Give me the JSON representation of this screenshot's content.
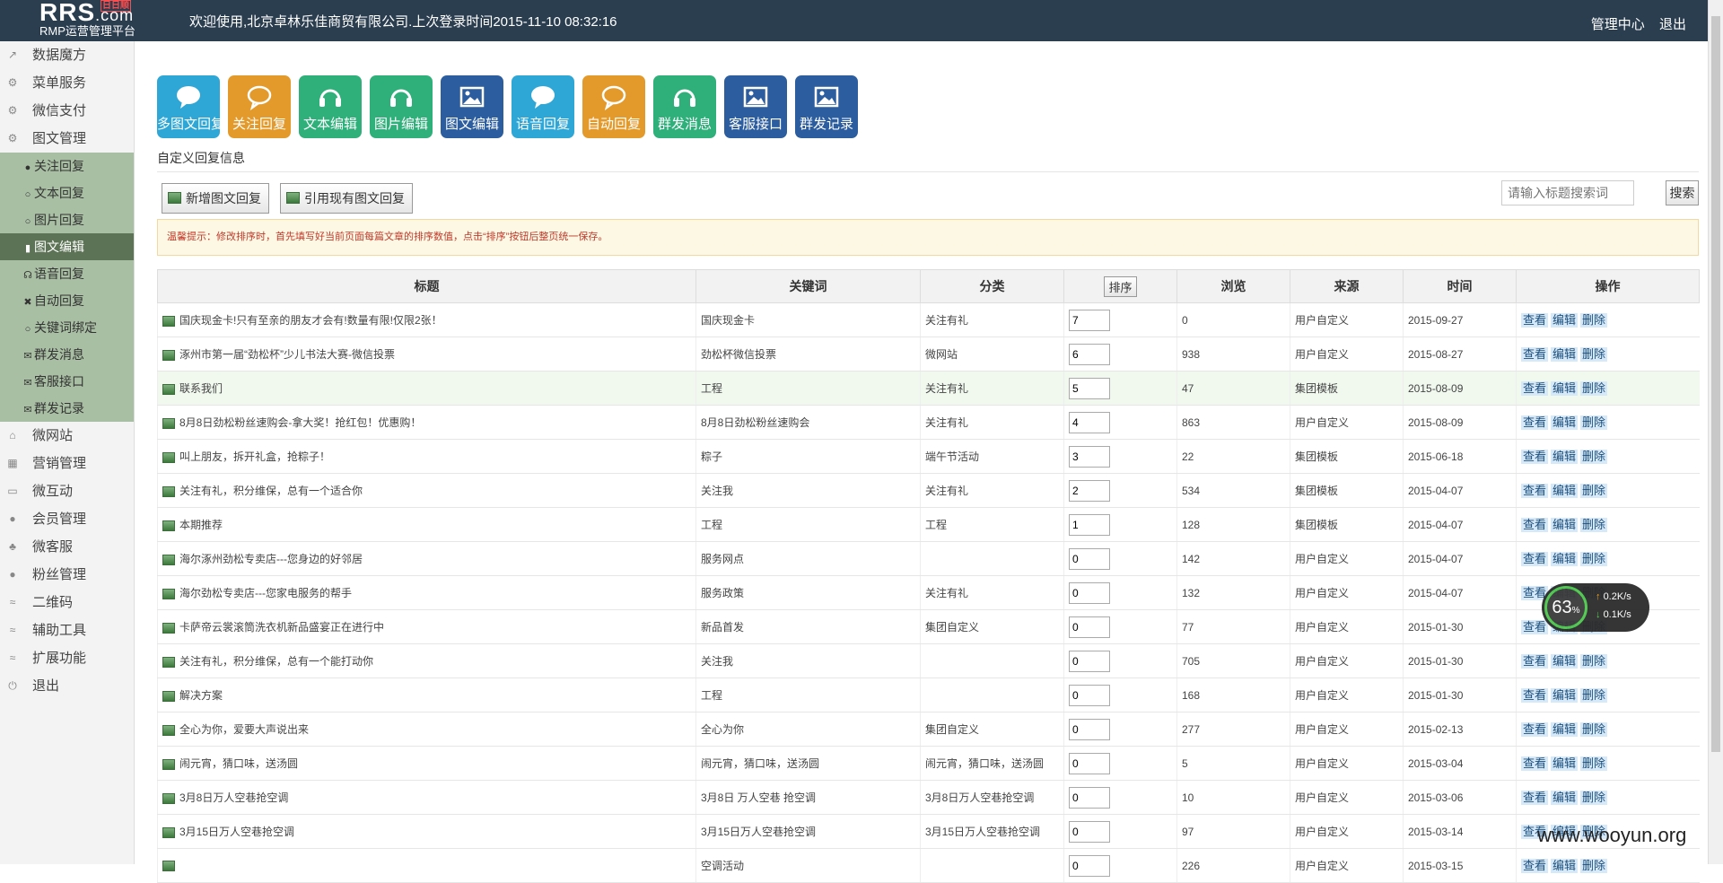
{
  "header": {
    "logo_brand": "RRS",
    "logo_domain": ".com",
    "logo_tag": "日日顺",
    "logo_sub": "RMP运营管理平台",
    "welcome": "欢迎使用,北京卓林乐佳商贸有限公司.上次登录时间2015-11-10 08:32:16",
    "link_admin": "管理中心",
    "link_logout": "退出"
  },
  "sidebar": {
    "top_items": [
      {
        "label": "数据魔方",
        "icon": "↗"
      },
      {
        "label": "菜单服务",
        "icon": "⚙"
      },
      {
        "label": "微信支付",
        "icon": "⚙"
      },
      {
        "label": "图文管理",
        "icon": "⚙"
      }
    ],
    "sub_items": [
      {
        "label": "关注回复",
        "icon": "●"
      },
      {
        "label": "文本回复",
        "icon": "○"
      },
      {
        "label": "图片回复",
        "icon": "○"
      },
      {
        "label": "图文编辑",
        "icon": "▮",
        "active": true
      },
      {
        "label": "语音回复",
        "icon": "☊"
      },
      {
        "label": "自动回复",
        "icon": "✖"
      },
      {
        "label": "关键词绑定",
        "icon": "○"
      },
      {
        "label": "群发消息",
        "icon": "✉"
      },
      {
        "label": "客服接口",
        "icon": "✉"
      },
      {
        "label": "群发记录",
        "icon": "✉"
      }
    ],
    "bottom_items": [
      {
        "label": "微网站",
        "icon": "⌂"
      },
      {
        "label": "营销管理",
        "icon": "▦"
      },
      {
        "label": "微互动",
        "icon": "▭"
      },
      {
        "label": "会员管理",
        "icon": "●"
      },
      {
        "label": "微客服",
        "icon": "♣"
      },
      {
        "label": "粉丝管理",
        "icon": "●"
      },
      {
        "label": "二维码",
        "icon": "≈"
      },
      {
        "label": "辅助工具",
        "icon": "≈"
      },
      {
        "label": "扩展功能",
        "icon": "≈"
      },
      {
        "label": "退出",
        "icon": "⏻"
      }
    ]
  },
  "tiles": [
    {
      "label": "多图文回复",
      "icon": "chat-icon",
      "color": "#2ea7d6"
    },
    {
      "label": "关注回复",
      "icon": "chat-outline-icon",
      "color": "#e39a2a"
    },
    {
      "label": "文本编辑",
      "icon": "headphones-icon",
      "color": "#2fb07a"
    },
    {
      "label": "图片编辑",
      "icon": "headphones-icon",
      "color": "#2fb07a"
    },
    {
      "label": "图文编辑",
      "icon": "picture-icon",
      "color": "#2c5d9f"
    },
    {
      "label": "语音回复",
      "icon": "chat-icon",
      "color": "#2ea7d6"
    },
    {
      "label": "自动回复",
      "icon": "chat-outline-icon",
      "color": "#e39a2a"
    },
    {
      "label": "群发消息",
      "icon": "headphones-icon",
      "color": "#2fb07a"
    },
    {
      "label": "客服接口",
      "icon": "picture-icon",
      "color": "#2c5d9f"
    },
    {
      "label": "群发记录",
      "icon": "picture-icon",
      "color": "#2c5d9f"
    }
  ],
  "main": {
    "section_title": "自定义回复信息",
    "btn_new": "新增图文回复",
    "btn_ref": "引用现有图文回复",
    "search_placeholder": "请输入标题搜索词",
    "search_btn": "搜索",
    "notice": "温馨提示：修改排序时，首先填写好当前页面每篇文章的排序数值，点击“排序”按钮后整页统一保存。"
  },
  "table": {
    "headers": {
      "title": "标题",
      "keyword": "关键词",
      "category": "分类",
      "sort": "排序",
      "views": "浏览",
      "source": "来源",
      "time": "时间",
      "ops": "操作"
    },
    "op_labels": {
      "view": "查看",
      "edit": "编辑",
      "del": "删除"
    },
    "rows": [
      {
        "title": "国庆现金卡!只有至亲的朋友才会有!数量有限!仅限2张！",
        "keyword": "国庆现金卡",
        "category": "关注有礼",
        "sort": "7",
        "views": "0",
        "source": "用户自定义",
        "time": "2015-09-27"
      },
      {
        "title": "涿州市第一届“劲松杯”少儿书法大赛-微信投票",
        "keyword": "劲松杯微信投票",
        "category": "微网站",
        "sort": "6",
        "views": "938",
        "source": "用户自定义",
        "time": "2015-08-27"
      },
      {
        "title": "联系我们",
        "keyword": "工程",
        "category": "关注有礼",
        "sort": "5",
        "views": "47",
        "source": "集团模板",
        "time": "2015-08-09"
      },
      {
        "title": "8月8日劲松粉丝速购会-拿大奖！抢红包！优惠购！",
        "keyword": "8月8日劲松粉丝速购会",
        "category": "关注有礼",
        "sort": "4",
        "views": "863",
        "source": "用户自定义",
        "time": "2015-08-09"
      },
      {
        "title": "叫上朋友，拆开礼盒，抢粽子！",
        "keyword": "粽子",
        "category": "端午节活动",
        "sort": "3",
        "views": "22",
        "source": "集团模板",
        "time": "2015-06-18"
      },
      {
        "title": "关注有礼，积分维保，总有一个适合你",
        "keyword": "关注我",
        "category": "关注有礼",
        "sort": "2",
        "views": "534",
        "source": "集团模板",
        "time": "2015-04-07"
      },
      {
        "title": "本期推荐",
        "keyword": "工程",
        "category": "工程",
        "sort": "1",
        "views": "128",
        "source": "集团模板",
        "time": "2015-04-07"
      },
      {
        "title": "海尔涿州劲松专卖店---您身边的好邻居",
        "keyword": "服务网点",
        "category": "",
        "sort": "0",
        "views": "142",
        "source": "用户自定义",
        "time": "2015-04-07"
      },
      {
        "title": "海尔劲松专卖店---您家电服务的帮手",
        "keyword": "服务政策",
        "category": "关注有礼",
        "sort": "0",
        "views": "132",
        "source": "用户自定义",
        "time": "2015-04-07"
      },
      {
        "title": "卡萨帝云裳滚筒洗衣机新品盛宴正在进行中",
        "keyword": "新品首发",
        "category": "集团自定义",
        "sort": "0",
        "views": "77",
        "source": "用户自定义",
        "time": "2015-01-30"
      },
      {
        "title": "关注有礼，积分维保，总有一个能打动你",
        "keyword": "关注我",
        "category": "",
        "sort": "0",
        "views": "705",
        "source": "用户自定义",
        "time": "2015-01-30"
      },
      {
        "title": "解决方案",
        "keyword": "工程",
        "category": "",
        "sort": "0",
        "views": "168",
        "source": "用户自定义",
        "time": "2015-01-30"
      },
      {
        "title": "全心为你，爱要大声说出来",
        "keyword": "全心为你",
        "category": "集团自定义",
        "sort": "0",
        "views": "277",
        "source": "用户自定义",
        "time": "2015-02-13"
      },
      {
        "title": "闹元宵，猜口味，送汤圆",
        "keyword": "闹元宵，猜口味，送汤圆",
        "category": "闹元宵，猜口味，送汤圆",
        "sort": "0",
        "views": "5",
        "source": "用户自定义",
        "time": "2015-03-04"
      },
      {
        "title": "3月8日万人空巷抢空调",
        "keyword": "3月8日 万人空巷 抢空调",
        "category": "3月8日万人空巷抢空调",
        "sort": "0",
        "views": "10",
        "source": "用户自定义",
        "time": "2015-03-06"
      },
      {
        "title": "3月15日万人空巷抢空调",
        "keyword": "3月15日万人空巷抢空调",
        "category": "3月15日万人空巷抢空调",
        "sort": "0",
        "views": "97",
        "source": "用户自定义",
        "time": "2015-03-14"
      },
      {
        "title": "",
        "keyword": "空调活动",
        "category": "",
        "sort": "0",
        "views": "226",
        "source": "用户自定义",
        "time": "2015-03-15"
      }
    ]
  },
  "net_widget": {
    "percent": "63",
    "unit": "%",
    "up": "0.2",
    "down": "0.1",
    "rate_unit": "K/s"
  },
  "watermark": "www.wooyun.org"
}
